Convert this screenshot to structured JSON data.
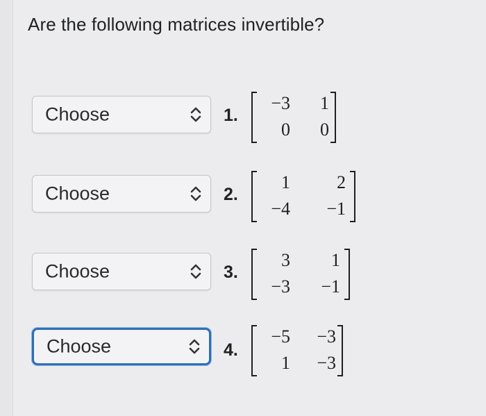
{
  "question": "Are the following matrices invertible?",
  "items": [
    {
      "select": "Choose",
      "num": "1.",
      "matrix": [
        [
          "−3",
          "1"
        ],
        [
          "0",
          "0"
        ]
      ]
    },
    {
      "select": "Choose",
      "num": "2.",
      "matrix": [
        [
          "1",
          "2"
        ],
        [
          "−4",
          "−1"
        ]
      ]
    },
    {
      "select": "Choose",
      "num": "3.",
      "matrix": [
        [
          "3",
          "1"
        ],
        [
          "−3",
          "−1"
        ]
      ]
    },
    {
      "select": "Choose",
      "num": "4.",
      "matrix": [
        [
          "−5",
          "−3"
        ],
        [
          "1",
          "−3"
        ]
      ]
    }
  ],
  "colors": {
    "background": "#ececee",
    "focus_border": "#2f6fb7",
    "text": "#202124"
  },
  "icons": {
    "select_arrow": "chevron-up-down-icon"
  }
}
